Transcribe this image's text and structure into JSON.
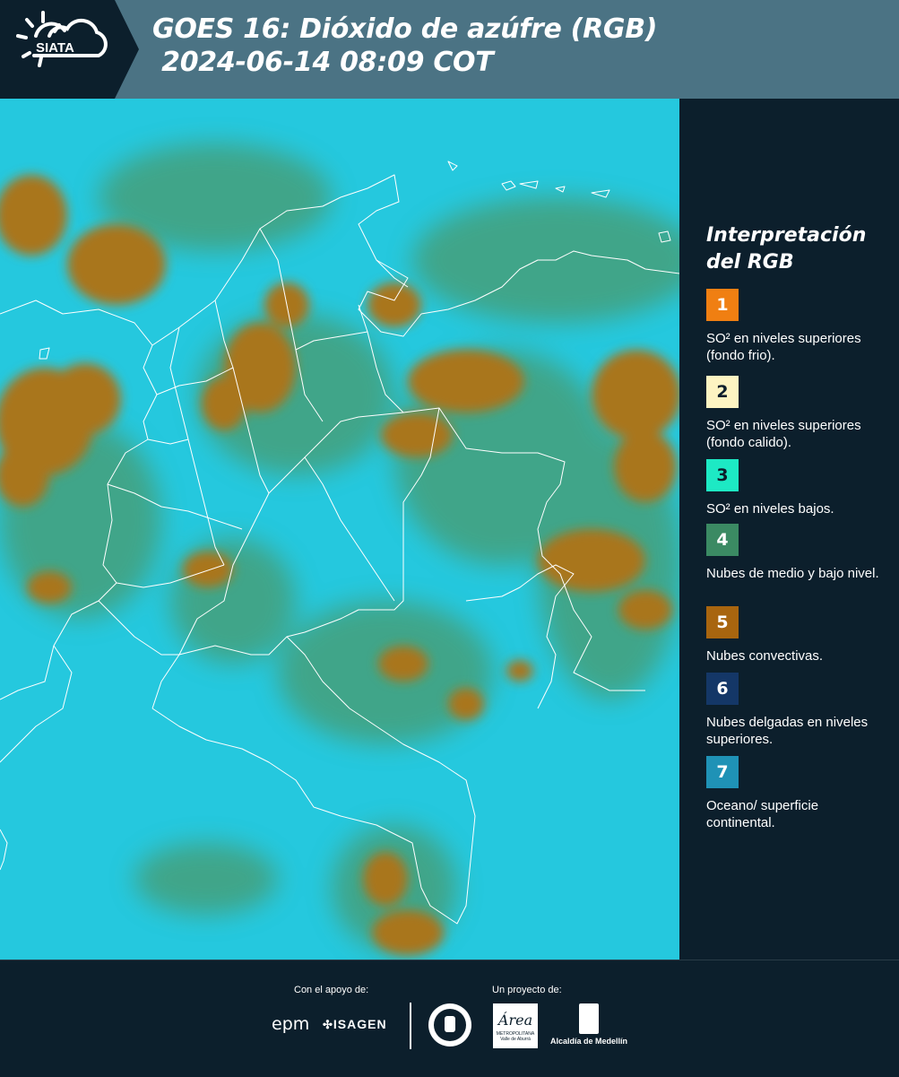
{
  "header": {
    "logo_text": "SIATA",
    "title_line1": "GOES 16: Dióxido de azúfre (RGB)",
    "title_line2": " 2024-06-14 08:09 COT"
  },
  "legend": {
    "title": "Interpretación del RGB",
    "items": [
      {
        "number": "1",
        "color": "#f07f12",
        "text": "SO² en niveles superiores (fondo frio)."
      },
      {
        "number": "2",
        "color": "#fdf4c2",
        "text": "SO² en niveles superiores (fondo calido)."
      },
      {
        "number": "3",
        "color": "#1de9c4",
        "text": "SO² en niveles bajos."
      },
      {
        "number": "4",
        "color": "#3b8a63",
        "text": "Nubes de medio y bajo nivel."
      },
      {
        "number": "5",
        "color": "#a8650f",
        "text": "Nubes convectivas."
      },
      {
        "number": "6",
        "color": "#143767",
        "text": "Nubes delgadas en niveles superiores."
      },
      {
        "number": "7",
        "color": "#1f92b6",
        "text": "Oceano/ superficie continental."
      }
    ]
  },
  "footer": {
    "support_label": "Con el apoyo de:",
    "project_label": "Un proyecto de:",
    "sponsors": [
      "epm",
      "ISAGEN"
    ],
    "partners": [
      "Área Metropolitana Valle de Aburrá",
      "Alcaldía de Medellín"
    ],
    "area_logo_text": "Área",
    "area_logo_sub": "METROPOLITANA Valle de Aburrá",
    "alcaldia_text": "Alcaldía de Medellín"
  },
  "colors": {
    "background": "#0c1f2c",
    "header": "#4b7384",
    "ocean": "#23c6dc",
    "cloud_convective": "#a8741e",
    "cloud_midlevel": "#4f9a6a"
  }
}
